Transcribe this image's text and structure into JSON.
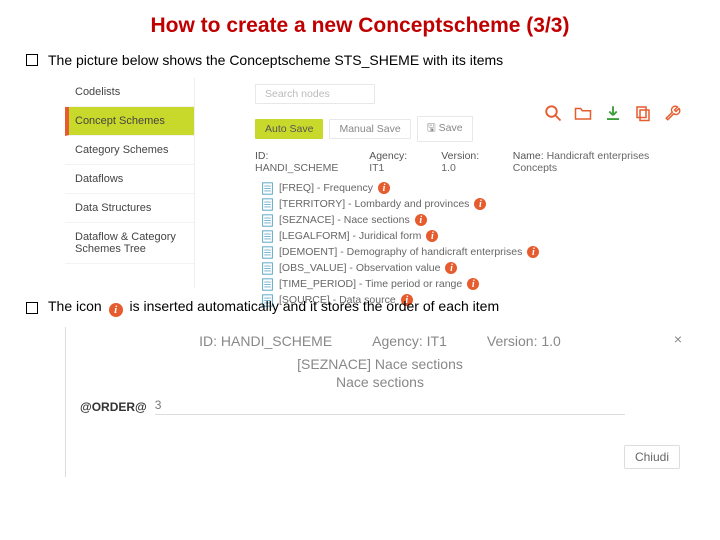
{
  "title": "How to create a new Conceptscheme (3/3)",
  "bullets": {
    "b1": "The picture below shows the Conceptscheme STS_SHEME with its items",
    "b2_before": "The icon",
    "b2_after": "is inserted automatically and it stores the order of each item"
  },
  "shot1": {
    "nav": {
      "codelists": "Codelists",
      "concept": "Concept Schemes",
      "category": "Category Schemes",
      "dataflows": "Dataflows",
      "datastruct": "Data Structures",
      "dctree": "Dataflow & Category Schemes Tree"
    },
    "search_placeholder": "Search nodes",
    "btn_auto": "Auto Save",
    "btn_manual": "Manual Save",
    "btn_save": "Save",
    "meta": {
      "id_lbl": "ID:",
      "id_val": "HANDI_SCHEME",
      "ag_lbl": "Agency:",
      "ag_val": "IT1",
      "ver_lbl": "Version:",
      "ver_val": "1.0",
      "name_lbl": "Name:",
      "name_val": "Handicraft enterprises Concepts"
    },
    "tree": {
      "it0": "[FREQ] - Frequency",
      "it1": "[TERRITORY] - Lombardy and provinces",
      "it2": "[SEZNACE] - Nace sections",
      "it3": "[LEGALFORM] - Juridical form",
      "it4": "[DEMOENT] - Demography of handicraft enterprises",
      "it5": "[OBS_VALUE] - Observation value",
      "it6": "[TIME_PERIOD] - Time period or range",
      "it7": "[SOURCE] - Data source"
    }
  },
  "shot2": {
    "id_lbl": "ID:",
    "id_val": "HANDI_SCHEME",
    "ag_lbl": "Agency:",
    "ag_val": "IT1",
    "ver_lbl": "Version:",
    "ver_val": "1.0",
    "itemcode": "[SEZNACE] Nace sections",
    "itemlabel": "Nace sections",
    "order_lbl": "@ORDER@",
    "order_val": "3",
    "close_btn": "Chiudi",
    "close_x": "×"
  },
  "glyphs": {
    "i": "i",
    "save_prefix": "🖫 "
  }
}
